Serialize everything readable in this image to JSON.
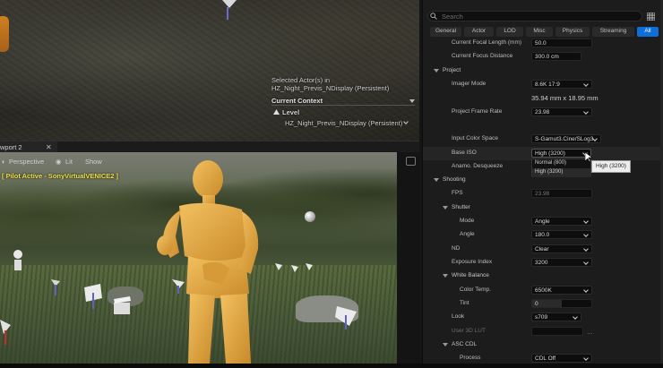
{
  "viewport_top": {
    "selected_actor_line1": "Selected Actor(s) in",
    "selected_actor_line2": "HZ_Night_Previs_NDisplay (Persistent)",
    "current_context_label": "Current Context",
    "level_label": "Level",
    "level_value": "HZ_Night_Previs_NDisplay (Persistent)"
  },
  "viewport_bottom": {
    "tab_label": "wport 2",
    "perspective_label": "Perspective",
    "lit_label": "Lit",
    "show_label": "Show",
    "pilot_text": "[ Pilot Active - SonyVirtualVENICE2 ]"
  },
  "details": {
    "search_placeholder": "Search",
    "tabs": [
      "General",
      "Actor",
      "LOD",
      "Misc",
      "Physics",
      "Streaming",
      "All"
    ],
    "active_tab": "All",
    "current_focal_length": {
      "label": "Current Focal Length (mm)",
      "value": "50.0"
    },
    "current_focus_distance": {
      "label": "Current Focus Distance",
      "value": "300.0 cm"
    },
    "project_category": "Project",
    "imager_mode": {
      "label": "Imager Mode",
      "value": "8.6K 17:9"
    },
    "sensor_size": "35.94 mm x 18.95 mm",
    "frame_rate": {
      "label": "Project Frame Rate",
      "value": "23.98"
    },
    "input_color_space": {
      "label": "Input Color Space",
      "value": "S-Gamut3.Cine/SLog3"
    },
    "base_iso": {
      "label": "Base ISO",
      "value": "High (3200)",
      "options": [
        "Normal (800)",
        "High (3200)"
      ],
      "tooltip": "High (3200)"
    },
    "anamorphic": {
      "label": "Anamo. Desqueeze"
    },
    "shooting_category": "Shooting",
    "fps": {
      "label": "FPS",
      "value": "23.98"
    },
    "shutter_category": "Shutter",
    "shutter_mode": {
      "label": "Mode",
      "value": "Angle"
    },
    "shutter_angle": {
      "label": "Angle",
      "value": "180.0"
    },
    "nd": {
      "label": "ND",
      "value": "Clear"
    },
    "exposure_index": {
      "label": "Exposure Index",
      "value": "3200"
    },
    "white_balance_category": "White Balance",
    "color_temp": {
      "label": "Color Temp.",
      "value": "6500K"
    },
    "tint": {
      "label": "Tint",
      "value": "0",
      "fill": 0.5
    },
    "look": {
      "label": "Look",
      "value": "s709"
    },
    "user_3d_lut": {
      "label": "User 3D LUT"
    },
    "asc_cdl_category": "ASC CDL",
    "process": {
      "label": "Process",
      "value": "CDL Off"
    }
  },
  "colors": {
    "accent": "#0e6fd8",
    "pilot_text": "#f0e040",
    "mannequin": "#e3a640"
  }
}
